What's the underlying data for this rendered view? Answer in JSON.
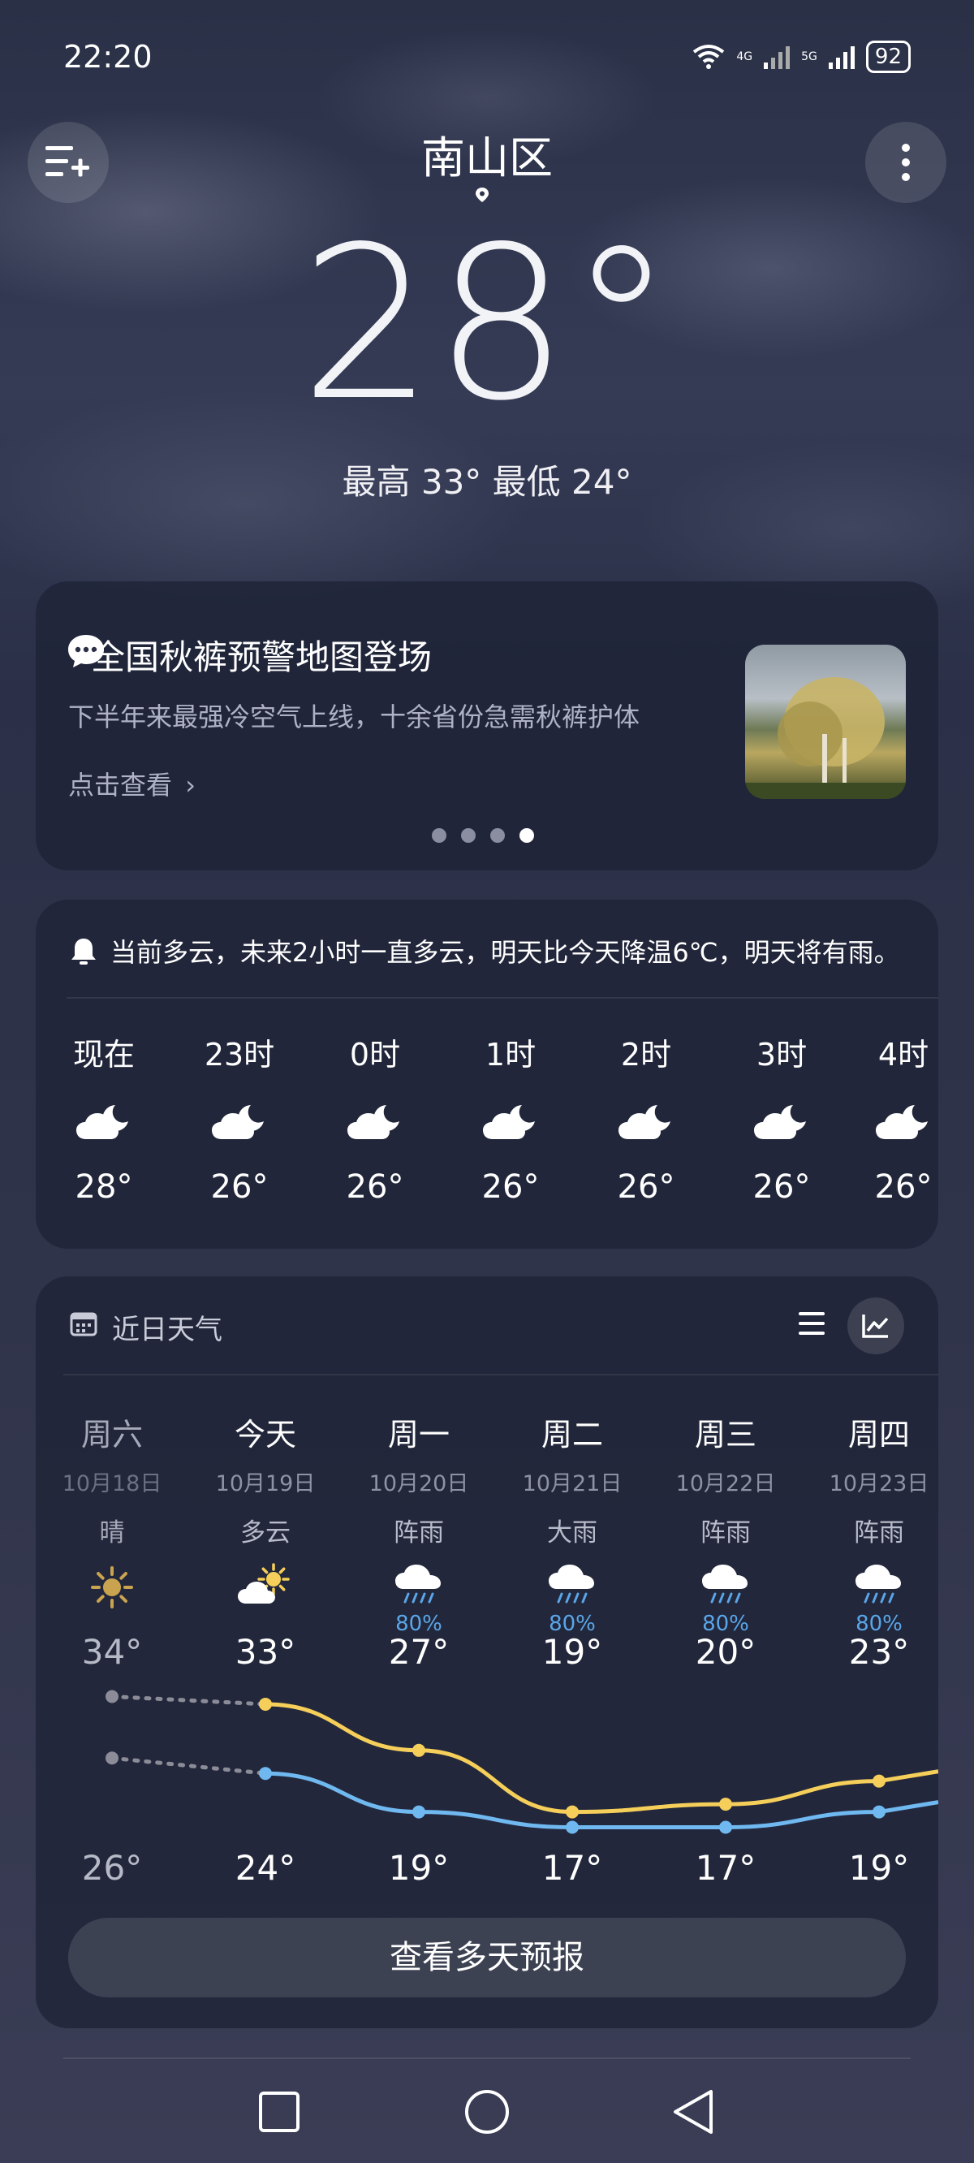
{
  "status_bar": {
    "time": "22:20",
    "battery": "92",
    "signal_1": "4G",
    "signal_2": "5G"
  },
  "header": {
    "city": "南山区",
    "current_temp": "28°",
    "hi_lo": "最高 33° 最低 24°",
    "menu_icon": "add-city-list-icon",
    "more_icon": "more-vertical-icon"
  },
  "news": {
    "title": "全国秋裤预警地图登场",
    "subtitle": "下半年来最强冷空气上线，十余省份急需秋裤护体",
    "link": "点击查看",
    "active_dot": 4,
    "dot_count": 4
  },
  "hourly": {
    "alert": "当前多云，未来2小时一直多云，明天比今天降温6℃，明天将有雨。",
    "items": [
      {
        "time": "现在",
        "temp": "28°",
        "icon": "cloudy-night-icon"
      },
      {
        "time": "23时",
        "temp": "26°",
        "icon": "cloudy-night-icon"
      },
      {
        "time": "0时",
        "temp": "26°",
        "icon": "cloudy-night-icon"
      },
      {
        "time": "1时",
        "temp": "26°",
        "icon": "cloudy-night-icon"
      },
      {
        "time": "2时",
        "temp": "26°",
        "icon": "cloudy-night-icon"
      },
      {
        "time": "3时",
        "temp": "26°",
        "icon": "cloudy-night-icon"
      },
      {
        "time": "4时",
        "temp": "26°",
        "icon": "cloudy-night-icon"
      }
    ]
  },
  "daily": {
    "title": "近日天气",
    "more_label": "查看多天预报",
    "days": [
      {
        "name": "周六",
        "date": "10月18日",
        "cond": "晴",
        "pop": "",
        "high": "34°",
        "low": "26°",
        "icon": "sunny-icon",
        "past": true
      },
      {
        "name": "今天",
        "date": "10月19日",
        "cond": "多云",
        "pop": "",
        "high": "33°",
        "low": "24°",
        "icon": "partly-cloudy-icon",
        "past": false
      },
      {
        "name": "周一",
        "date": "10月20日",
        "cond": "阵雨",
        "pop": "80%",
        "high": "27°",
        "low": "19°",
        "icon": "rain-icon",
        "past": false
      },
      {
        "name": "周二",
        "date": "10月21日",
        "cond": "大雨",
        "pop": "80%",
        "high": "19°",
        "low": "17°",
        "icon": "rain-icon",
        "past": false
      },
      {
        "name": "周三",
        "date": "10月22日",
        "cond": "阵雨",
        "pop": "80%",
        "high": "20°",
        "low": "17°",
        "icon": "rain-icon",
        "past": false
      },
      {
        "name": "周四",
        "date": "10月23日",
        "cond": "阵雨",
        "pop": "80%",
        "high": "23°",
        "low": "19°",
        "icon": "rain-icon",
        "past": false
      }
    ],
    "high_values": [
      34,
      33,
      27,
      19,
      20,
      23
    ],
    "low_values": [
      26,
      24,
      19,
      17,
      17,
      19
    ],
    "colors": {
      "high": "#f5cf5a",
      "low": "#6fb8f0",
      "past": "#8b8c97"
    }
  },
  "nav": {
    "recent": "square-icon",
    "home": "circle-icon",
    "back": "triangle-back-icon"
  }
}
